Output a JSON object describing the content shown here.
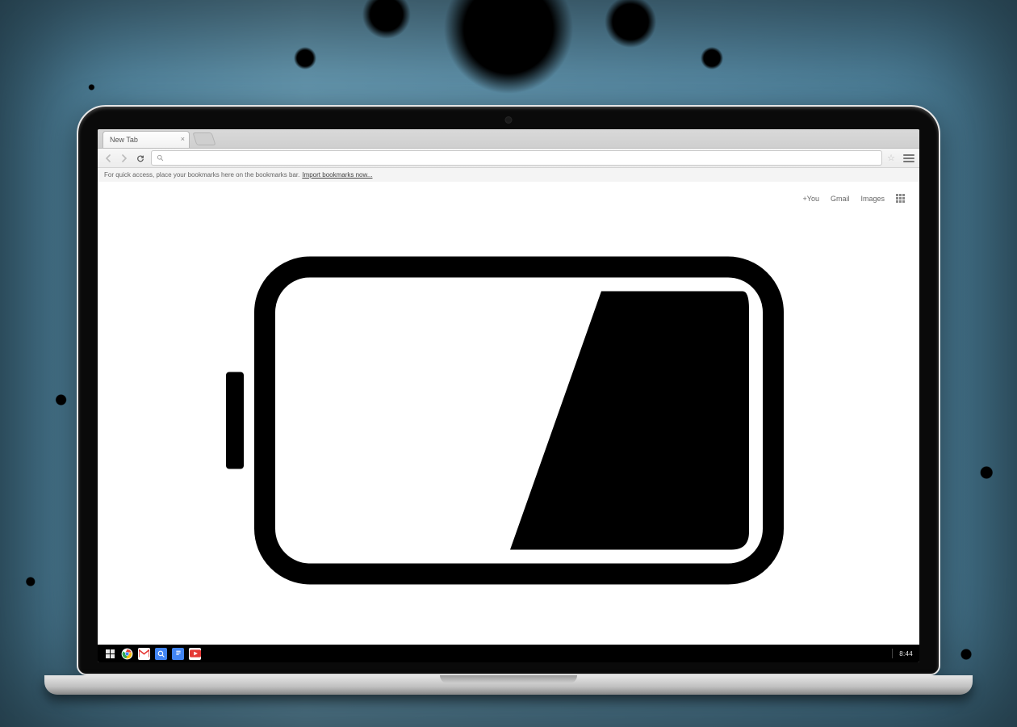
{
  "browser": {
    "tab_title": "New Tab",
    "bookmark_bar_hint": "For quick access, place your bookmarks here on the bookmarks bar.",
    "bookmark_bar_link": "Import bookmarks now...",
    "top_links": {
      "plus_you": "+You",
      "gmail": "Gmail",
      "images": "Images"
    }
  },
  "taskbar": {
    "clock": "8:44"
  }
}
